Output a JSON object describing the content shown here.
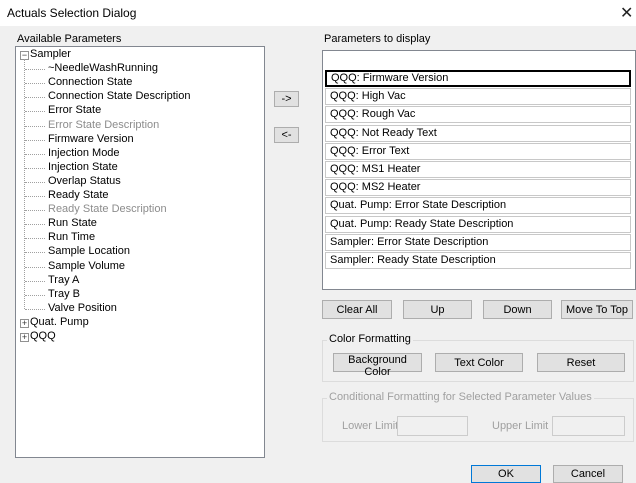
{
  "window": {
    "title": "Actuals Selection Dialog",
    "close_glyph": "✕"
  },
  "available": {
    "label": "Available Parameters",
    "tree": {
      "sampler": {
        "label": "Sampler",
        "children": [
          {
            "label": "~NeedleWashRunning",
            "disabled": false
          },
          {
            "label": "Connection State",
            "disabled": false
          },
          {
            "label": "Connection State Description",
            "disabled": false
          },
          {
            "label": "Error State",
            "disabled": false
          },
          {
            "label": "Error State Description",
            "disabled": true
          },
          {
            "label": "Firmware Version",
            "disabled": false
          },
          {
            "label": "Injection Mode",
            "disabled": false
          },
          {
            "label": "Injection State",
            "disabled": false
          },
          {
            "label": "Overlap Status",
            "disabled": false
          },
          {
            "label": "Ready State",
            "disabled": false
          },
          {
            "label": "Ready State Description",
            "disabled": true
          },
          {
            "label": "Run State",
            "disabled": false
          },
          {
            "label": "Run Time",
            "disabled": false
          },
          {
            "label": "Sample Location",
            "disabled": false
          },
          {
            "label": "Sample Volume",
            "disabled": false
          },
          {
            "label": "Tray A",
            "disabled": false
          },
          {
            "label": "Tray B",
            "disabled": false
          },
          {
            "label": "Valve Position",
            "disabled": false
          }
        ]
      },
      "quat_pump": {
        "label": "Quat. Pump"
      },
      "qqq": {
        "label": "QQQ"
      },
      "expanded_glyph": "−",
      "collapsed_glyph": "+"
    }
  },
  "transfer": {
    "add_label": "->",
    "remove_label": "<-"
  },
  "display": {
    "label": "Parameters to display",
    "items": [
      "QQQ:  Firmware Version",
      "QQQ:  High Vac",
      "QQQ:  Rough Vac",
      "QQQ:  Not Ready Text",
      "QQQ:  Error Text",
      "QQQ:  MS1 Heater",
      "QQQ:  MS2 Heater",
      "Quat. Pump:  Error State Description",
      "Quat. Pump:  Ready State Description",
      "Sampler:  Error State Description",
      "Sampler:  Ready State Description"
    ],
    "selected_index": 0
  },
  "list_buttons": {
    "clear_all": "Clear All",
    "up": "Up",
    "down": "Down",
    "move_to_top": "Move To Top"
  },
  "color_formatting": {
    "title": "Color Formatting",
    "background_color": "Background Color",
    "text_color": "Text Color",
    "reset": "Reset"
  },
  "conditional": {
    "title": "Conditional  Formatting for Selected Parameter Values",
    "lower_limit": "Lower Limit",
    "upper_limit": "Upper Limit",
    "lower_value": "",
    "upper_value": ""
  },
  "footer": {
    "ok": "OK",
    "cancel": "Cancel"
  }
}
